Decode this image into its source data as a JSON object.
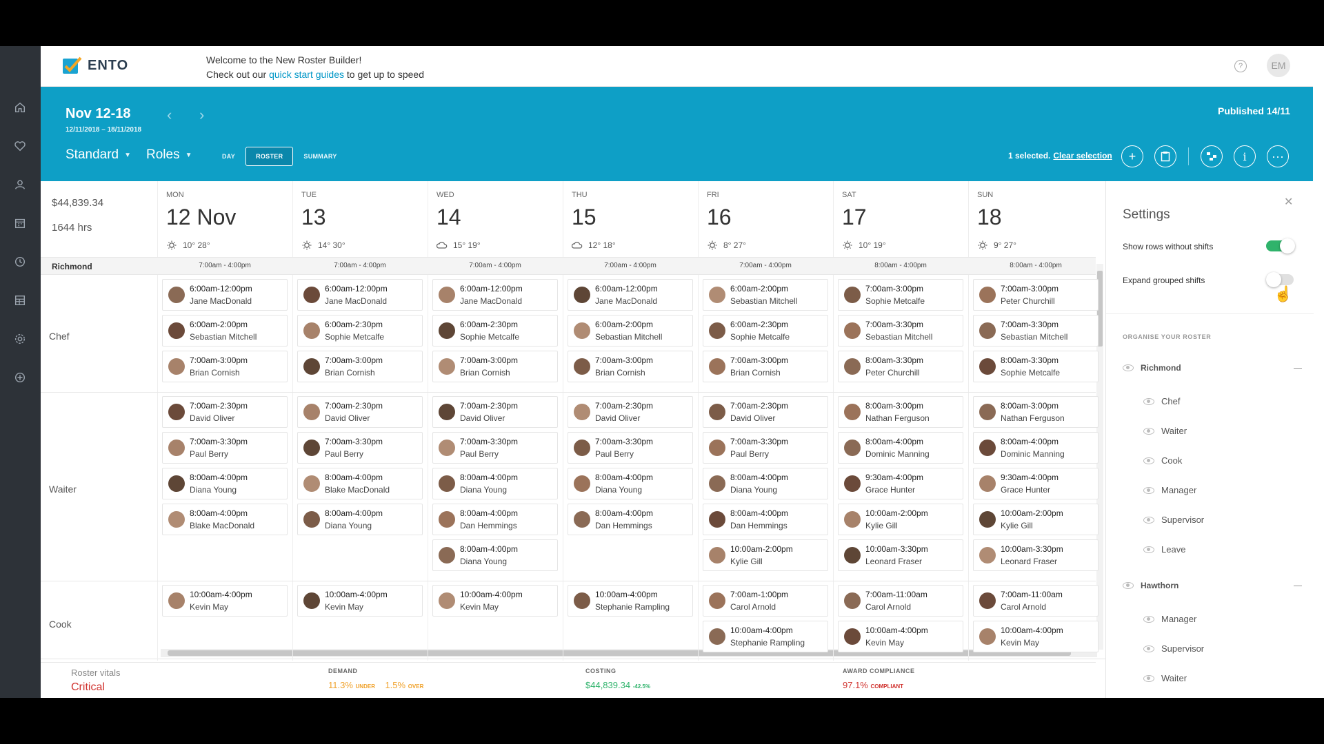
{
  "brand": {
    "name": "ENTO"
  },
  "welcome": {
    "line1": "Welcome to the New Roster Builder!",
    "line2_prefix": "Check out our ",
    "link": "quick start guides",
    "line2_suffix": " to get up to speed"
  },
  "user": {
    "initials": "EM"
  },
  "header": {
    "week_title": "Nov 12-18",
    "week_range": "12/11/2018 – 18/11/2018",
    "published": "Published 14/11",
    "template_select": "Standard",
    "group_select": "Roles",
    "view_tabs": [
      "DAY",
      "ROSTER",
      "SUMMARY"
    ],
    "active_tab": "ROSTER",
    "selection_text": "1 selected.",
    "clear_selection": "Clear selection"
  },
  "totals": {
    "cost": "$44,839.34",
    "hours": "1644 hrs"
  },
  "days": [
    {
      "dow": "MON",
      "date": "12 Nov",
      "weather": "10° 28°",
      "icon": "sun-icon",
      "hours": "7:00am - 4:00pm"
    },
    {
      "dow": "TUE",
      "date": "13",
      "weather": "14° 30°",
      "icon": "sun-icon",
      "hours": "7:00am - 4:00pm"
    },
    {
      "dow": "WED",
      "date": "14",
      "weather": "15° 19°",
      "icon": "cloud-icon",
      "hours": "7:00am - 4:00pm"
    },
    {
      "dow": "THU",
      "date": "15",
      "weather": "12° 18°",
      "icon": "partly-cloudy-icon",
      "hours": "7:00am - 4:00pm"
    },
    {
      "dow": "FRI",
      "date": "16",
      "weather": "8° 27°",
      "icon": "sun-icon",
      "hours": "7:00am - 4:00pm"
    },
    {
      "dow": "SAT",
      "date": "17",
      "weather": "10° 19°",
      "icon": "sun-icon",
      "hours": "8:00am - 4:00pm"
    },
    {
      "dow": "SUN",
      "date": "18",
      "weather": "9° 27°",
      "icon": "sun-icon",
      "hours": "8:00am - 4:00pm"
    }
  ],
  "location": "Richmond",
  "roles": [
    {
      "name": "Chef",
      "days": [
        [
          {
            "t": "6:00am-12:00pm",
            "n": "Jane MacDonald"
          },
          {
            "t": "6:00am-2:00pm",
            "n": "Sebastian Mitchell"
          },
          {
            "t": "7:00am-3:00pm",
            "n": "Brian Cornish"
          }
        ],
        [
          {
            "t": "6:00am-12:00pm",
            "n": "Jane MacDonald"
          },
          {
            "t": "6:00am-2:30pm",
            "n": "Sophie Metcalfe"
          },
          {
            "t": "7:00am-3:00pm",
            "n": "Brian Cornish"
          }
        ],
        [
          {
            "t": "6:00am-12:00pm",
            "n": "Jane MacDonald"
          },
          {
            "t": "6:00am-2:30pm",
            "n": "Sophie Metcalfe"
          },
          {
            "t": "7:00am-3:00pm",
            "n": "Brian Cornish"
          }
        ],
        [
          {
            "t": "6:00am-12:00pm",
            "n": "Jane MacDonald"
          },
          {
            "t": "6:00am-2:00pm",
            "n": "Sebastian Mitchell"
          },
          {
            "t": "7:00am-3:00pm",
            "n": "Brian Cornish"
          }
        ],
        [
          {
            "t": "6:00am-2:00pm",
            "n": "Sebastian Mitchell"
          },
          {
            "t": "6:00am-2:30pm",
            "n": "Sophie Metcalfe"
          },
          {
            "t": "7:00am-3:00pm",
            "n": "Brian Cornish"
          }
        ],
        [
          {
            "t": "7:00am-3:00pm",
            "n": "Sophie Metcalfe"
          },
          {
            "t": "7:00am-3:30pm",
            "n": "Sebastian Mitchell"
          },
          {
            "t": "8:00am-3:30pm",
            "n": "Peter Churchill"
          }
        ],
        [
          {
            "t": "7:00am-3:00pm",
            "n": "Peter Churchill"
          },
          {
            "t": "7:00am-3:30pm",
            "n": "Sebastian Mitchell"
          },
          {
            "t": "8:00am-3:30pm",
            "n": "Sophie Metcalfe"
          }
        ]
      ]
    },
    {
      "name": "Waiter",
      "days": [
        [
          {
            "t": "7:00am-2:30pm",
            "n": "David Oliver"
          },
          {
            "t": "7:00am-3:30pm",
            "n": "Paul Berry"
          },
          {
            "t": "8:00am-4:00pm",
            "n": "Diana Young"
          },
          {
            "t": "8:00am-4:00pm",
            "n": "Blake MacDonald"
          }
        ],
        [
          {
            "t": "7:00am-2:30pm",
            "n": "David Oliver"
          },
          {
            "t": "7:00am-3:30pm",
            "n": "Paul Berry"
          },
          {
            "t": "8:00am-4:00pm",
            "n": "Blake MacDonald"
          },
          {
            "t": "8:00am-4:00pm",
            "n": "Diana Young"
          }
        ],
        [
          {
            "t": "7:00am-2:30pm",
            "n": "David Oliver"
          },
          {
            "t": "7:00am-3:30pm",
            "n": "Paul Berry"
          },
          {
            "t": "8:00am-4:00pm",
            "n": "Diana Young"
          },
          {
            "t": "8:00am-4:00pm",
            "n": "Dan Hemmings"
          },
          {
            "t": "8:00am-4:00pm",
            "n": "Diana Young"
          }
        ],
        [
          {
            "t": "7:00am-2:30pm",
            "n": "David Oliver"
          },
          {
            "t": "7:00am-3:30pm",
            "n": "Paul Berry"
          },
          {
            "t": "8:00am-4:00pm",
            "n": "Diana Young"
          },
          {
            "t": "8:00am-4:00pm",
            "n": "Dan Hemmings"
          }
        ],
        [
          {
            "t": "7:00am-2:30pm",
            "n": "David Oliver"
          },
          {
            "t": "7:00am-3:30pm",
            "n": "Paul Berry"
          },
          {
            "t": "8:00am-4:00pm",
            "n": "Diana Young"
          },
          {
            "t": "8:00am-4:00pm",
            "n": "Dan Hemmings"
          },
          {
            "t": "10:00am-2:00pm",
            "n": "Kylie Gill"
          }
        ],
        [
          {
            "t": "8:00am-3:00pm",
            "n": "Nathan Ferguson"
          },
          {
            "t": "8:00am-4:00pm",
            "n": "Dominic Manning"
          },
          {
            "t": "9:30am-4:00pm",
            "n": "Grace Hunter"
          },
          {
            "t": "10:00am-2:00pm",
            "n": "Kylie Gill"
          },
          {
            "t": "10:00am-3:30pm",
            "n": "Leonard Fraser"
          }
        ],
        [
          {
            "t": "8:00am-3:00pm",
            "n": "Nathan Ferguson"
          },
          {
            "t": "8:00am-4:00pm",
            "n": "Dominic Manning"
          },
          {
            "t": "9:30am-4:00pm",
            "n": "Grace Hunter"
          },
          {
            "t": "10:00am-2:00pm",
            "n": "Kylie Gill"
          },
          {
            "t": "10:00am-3:30pm",
            "n": "Leonard Fraser"
          }
        ]
      ]
    },
    {
      "name": "Cook",
      "days": [
        [
          {
            "t": "10:00am-4:00pm",
            "n": "Kevin May"
          }
        ],
        [
          {
            "t": "10:00am-4:00pm",
            "n": "Kevin May"
          }
        ],
        [
          {
            "t": "10:00am-4:00pm",
            "n": "Kevin May"
          }
        ],
        [
          {
            "t": "10:00am-4:00pm",
            "n": "Stephanie Rampling"
          }
        ],
        [
          {
            "t": "7:00am-1:00pm",
            "n": "Carol Arnold"
          },
          {
            "t": "10:00am-4:00pm",
            "n": "Stephanie Rampling"
          }
        ],
        [
          {
            "t": "7:00am-11:00am",
            "n": "Carol Arnold"
          },
          {
            "t": "10:00am-4:00pm",
            "n": "Kevin May"
          }
        ],
        [
          {
            "t": "7:00am-11:00am",
            "n": "Carol Arnold"
          },
          {
            "t": "10:00am-4:00pm",
            "n": "Kevin May"
          }
        ]
      ]
    }
  ],
  "vitals": {
    "label": "Roster vitals",
    "status": "Critical",
    "demand_label": "DEMAND",
    "demand_under": "11.3%",
    "under_word": "UNDER",
    "demand_over": "1.5%",
    "over_word": "OVER",
    "costing_label": "COSTING",
    "costing_value": "$44,839.34",
    "costing_delta": "-42.5%",
    "award_label": "AWARD COMPLIANCE",
    "award_value": "97.1%",
    "award_word": "COMPLIANT"
  },
  "settings": {
    "title": "Settings",
    "show_rows_label": "Show rows without shifts",
    "show_rows_on": true,
    "expand_label": "Expand grouped shifts",
    "expand_on": false,
    "organise_label": "ORGANISE YOUR ROSTER",
    "locations": [
      {
        "name": "Richmond",
        "items": [
          "Chef",
          "Waiter",
          "Cook",
          "Manager",
          "Supervisor",
          "Leave"
        ]
      },
      {
        "name": "Hawthorn",
        "items": [
          "Manager",
          "Supervisor",
          "Waiter"
        ]
      }
    ]
  },
  "colors": {
    "accent": "#0e9fc6",
    "nav": "#2d3238",
    "critical": "#d0312d",
    "warning": "#f0a22c",
    "success": "#2fb36b",
    "toggle_on": "#2fb36b"
  }
}
